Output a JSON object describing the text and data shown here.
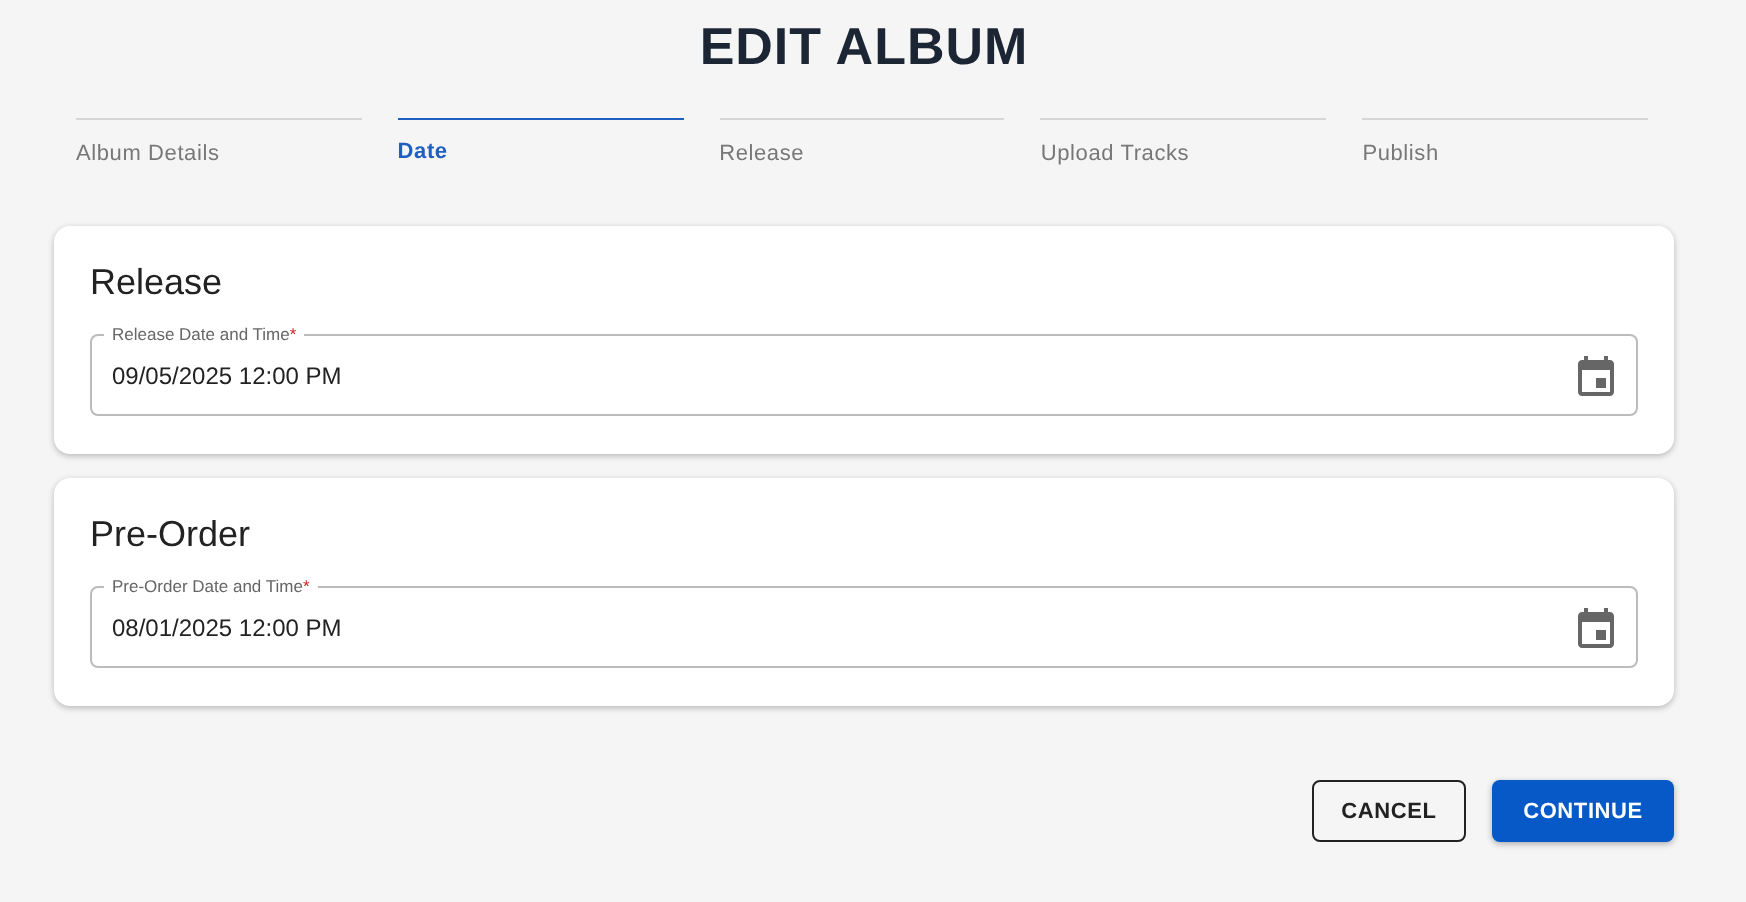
{
  "title": "EDIT ALBUM",
  "steps": [
    {
      "label": "Album Details",
      "selected": false
    },
    {
      "label": "Date",
      "selected": true
    },
    {
      "label": "Release",
      "selected": false
    },
    {
      "label": "Upload Tracks",
      "selected": false
    },
    {
      "label": "Publish",
      "selected": false
    }
  ],
  "sections": [
    {
      "title": "Release",
      "field": {
        "label": "Release Date and Time",
        "required_mark": "*",
        "value": "09/05/2025 12:00 PM"
      }
    },
    {
      "title": "Pre-Order",
      "field": {
        "label": "Pre-Order Date and Time",
        "required_mark": "*",
        "value": "08/01/2025 12:00 PM"
      }
    }
  ],
  "buttons": [
    {
      "label": "CANCEL",
      "kind": "outlined"
    },
    {
      "label": "CONTINUE",
      "kind": "primary"
    }
  ]
}
